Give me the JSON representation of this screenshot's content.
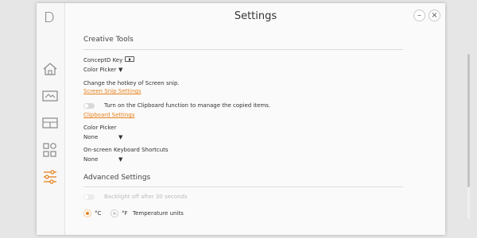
{
  "app": {
    "logo": "D",
    "title": "Settings"
  },
  "window_controls": {
    "minimize": "–",
    "close": "×"
  },
  "sidebar": {
    "items": [
      {
        "name": "home",
        "icon": "home-icon"
      },
      {
        "name": "display",
        "icon": "display-icon"
      },
      {
        "name": "layout",
        "icon": "layout-icon"
      },
      {
        "name": "apps",
        "icon": "apps-icon"
      },
      {
        "name": "settings",
        "icon": "sliders-icon",
        "active": true
      }
    ]
  },
  "creative_tools": {
    "heading": "Creative Tools",
    "conceptd_key": {
      "label": "ConceptD Key",
      "value": "Color Picker"
    },
    "screen_snip": {
      "label": "Change the hotkey of Screen snip.",
      "link": "Screen Snip Settings"
    },
    "clipboard": {
      "toggle_label": "Turn on the Clipboard function to manage the copied items.",
      "link": "Clipboard Settings",
      "enabled": false
    },
    "color_picker": {
      "label": "Color Picker",
      "value": "None"
    },
    "osk_shortcuts": {
      "label": "On-screen Keyboard Shortcuts",
      "value": "None"
    }
  },
  "advanced_settings": {
    "heading": "Advanced Settings",
    "backlight": {
      "label": "Backlight off after 30 seconds",
      "enabled": false,
      "disabled": true
    },
    "temperature": {
      "celsius": "°C",
      "fahrenheit": "°F",
      "label": "Temperature units",
      "selected": "celsius"
    }
  },
  "colors": {
    "accent": "#e8801a",
    "text": "#333333",
    "divider": "#dcdcdc"
  }
}
